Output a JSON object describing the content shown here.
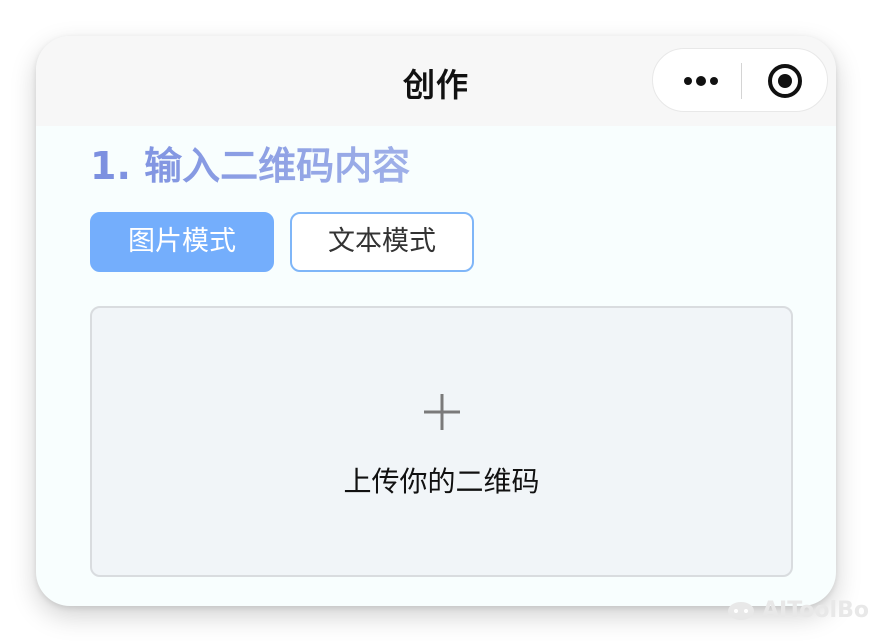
{
  "nav": {
    "title": "创作"
  },
  "section": {
    "heading": "1. 输入二维码内容",
    "modes": [
      {
        "label": "图片模式",
        "active": true
      },
      {
        "label": "文本模式",
        "active": false
      }
    ]
  },
  "upload": {
    "label": "上传你的二维码"
  },
  "watermark": {
    "text": "AIToolBo"
  },
  "icons": {
    "more": "more-dots-icon",
    "target": "record-target-icon",
    "plus": "plus-icon",
    "watermark": "bubble-logo-icon"
  },
  "colors": {
    "active_mode": "#74aefc",
    "inactive_border": "#7fb6f8",
    "heading_start": "#7b8fe0",
    "heading_end": "#9fb0e8",
    "upload_bg": "#f1f5f8"
  }
}
